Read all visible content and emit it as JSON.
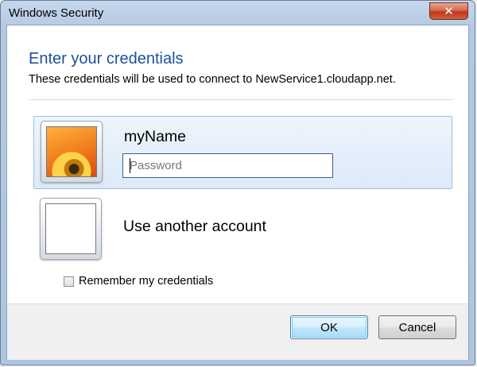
{
  "window": {
    "title": "Windows Security",
    "close_label": "✕"
  },
  "dialog": {
    "heading": "Enter your credentials",
    "description": "These credentials will be used to connect to NewService1.cloudapp.net."
  },
  "accounts": {
    "selected": {
      "username": "myName",
      "password_value": "",
      "password_placeholder": "Password"
    },
    "other": {
      "label": "Use another account"
    }
  },
  "remember": {
    "label": "Remember my credentials",
    "checked": false
  },
  "buttons": {
    "ok": "OK",
    "cancel": "Cancel"
  },
  "colors": {
    "heading": "#1d4f9c",
    "selected_tile": "#dceaf9",
    "close_button": "#c0391b"
  },
  "icons": {
    "user_picture": "orange-flower-user-tile",
    "close": "close-icon"
  }
}
